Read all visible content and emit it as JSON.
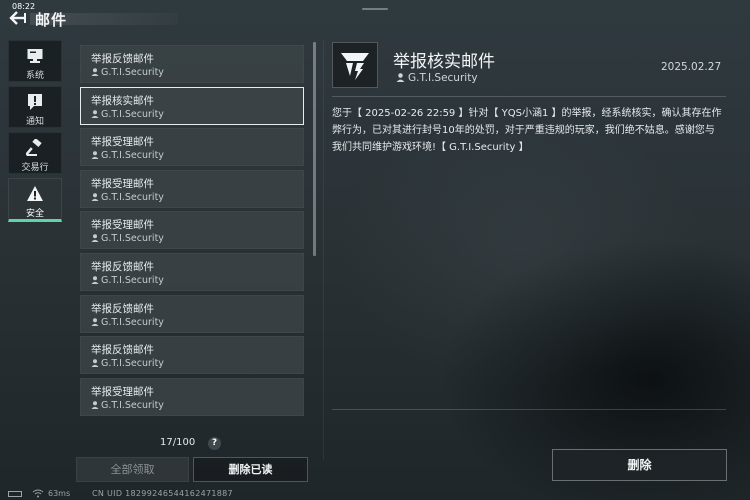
{
  "status_bar": {
    "time": "08:22",
    "ping": "63ms",
    "uid": "CN UID 182992465441624718​87"
  },
  "header": {
    "title": "邮件"
  },
  "nav": {
    "items": [
      {
        "label": "系统",
        "icon": "monitor-icon"
      },
      {
        "label": "通知",
        "icon": "alert-message-icon"
      },
      {
        "label": "交易行",
        "icon": "gavel-icon"
      },
      {
        "label": "安全",
        "icon": "warning-triangle-icon",
        "active": true
      }
    ]
  },
  "mail_list": {
    "items": [
      {
        "title": "举报反馈邮件",
        "sender": "G.T.I.Security"
      },
      {
        "title": "举报核实邮件",
        "sender": "G.T.I.Security",
        "selected": true
      },
      {
        "title": "举报受理邮件",
        "sender": "G.T.I.Security"
      },
      {
        "title": "举报受理邮件",
        "sender": "G.T.I.Security"
      },
      {
        "title": "举报受理邮件",
        "sender": "G.T.I.Security"
      },
      {
        "title": "举报反馈邮件",
        "sender": "G.T.I.Security"
      },
      {
        "title": "举报反馈邮件",
        "sender": "G.T.I.Security"
      },
      {
        "title": "举报反馈邮件",
        "sender": "G.T.I.Security"
      },
      {
        "title": "举报受理邮件",
        "sender": "G.T.I.Security"
      }
    ],
    "counter": "17/100",
    "help_label": "?",
    "claim_all_label": "全部领取",
    "delete_read_label": "删除已读"
  },
  "detail": {
    "title": "举报核实邮件",
    "sender": "G.T.I.Security",
    "date": "2025.02.27",
    "body": "您于【 2025-02-26 22:59 】针对【 YQS小涵1 】的举报，经系统核实，确认其存在作弊行为，已对其进行封号10年的处罚，对于严重违规的玩家，我们绝不姑息。感谢您与我们共同维护游戏环境!【 G.T.I.Security 】",
    "delete_label": "删除"
  },
  "colors": {
    "accent": "#5fd3a9",
    "background": "#2a3236"
  }
}
